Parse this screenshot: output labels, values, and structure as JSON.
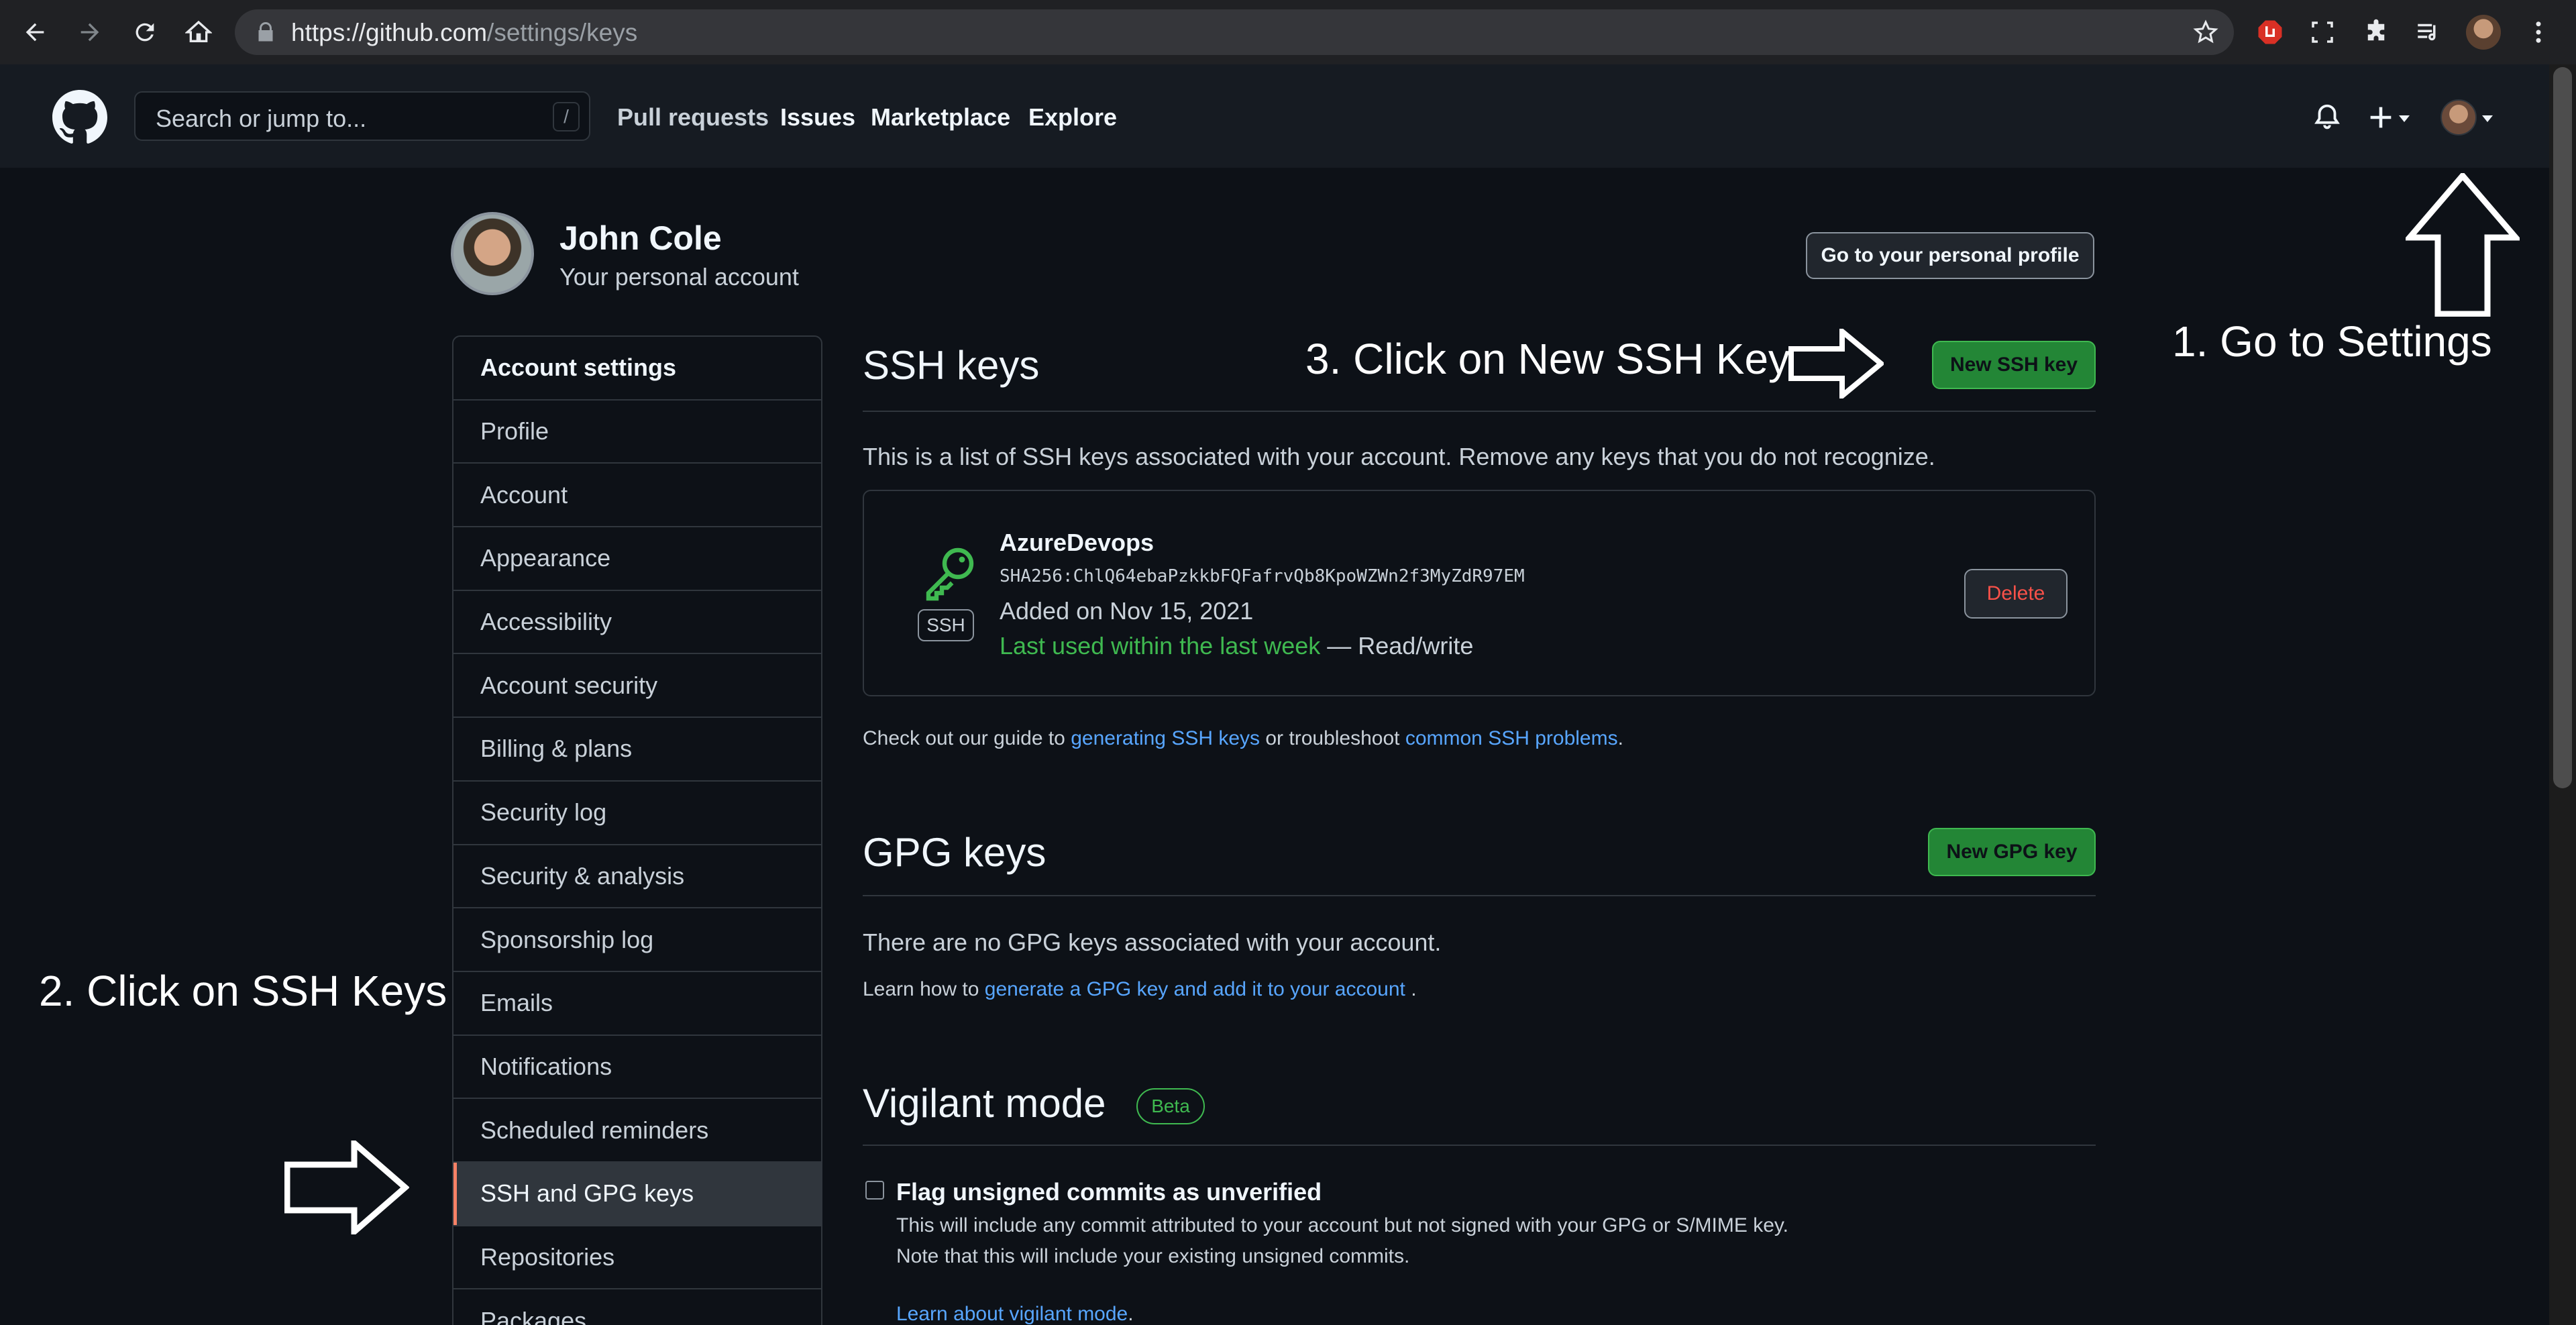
{
  "browser": {
    "url_host": "https://github.com",
    "url_path": "/settings/keys"
  },
  "header": {
    "search_placeholder": "Search or jump to...",
    "search_shortcut": "/",
    "nav": [
      "Pull requests",
      "Issues",
      "Marketplace",
      "Explore"
    ]
  },
  "profile": {
    "name": "John Cole",
    "subtitle": "Your personal account",
    "profile_button": "Go to your personal profile"
  },
  "sidebar": {
    "items": [
      {
        "label": "Account settings",
        "head": true
      },
      {
        "label": "Profile"
      },
      {
        "label": "Account"
      },
      {
        "label": "Appearance"
      },
      {
        "label": "Accessibility"
      },
      {
        "label": "Account security"
      },
      {
        "label": "Billing & plans"
      },
      {
        "label": "Security log"
      },
      {
        "label": "Security & analysis"
      },
      {
        "label": "Sponsorship log"
      },
      {
        "label": "Emails"
      },
      {
        "label": "Notifications"
      },
      {
        "label": "Scheduled reminders"
      },
      {
        "label": "SSH and GPG keys",
        "active": true
      },
      {
        "label": "Repositories"
      },
      {
        "label": "Packages"
      }
    ]
  },
  "ssh": {
    "title": "SSH keys",
    "new_button": "New SSH key",
    "description": "This is a list of SSH keys associated with your account. Remove any keys that you do not recognize.",
    "key": {
      "badge": "SSH",
      "name": "AzureDevops",
      "fingerprint": "SHA256:ChlQ64ebaPzkkbFQFafrvQb8KpoWZWn2f3MyZdR97EM",
      "added": "Added on Nov 15, 2021",
      "last_used": "Last used within the last week",
      "access": " — Read/write",
      "delete_button": "Delete"
    },
    "guide_prefix": "Check out our guide to ",
    "guide_link1": "generating SSH keys",
    "guide_middle": " or troubleshoot ",
    "guide_link2": "common SSH problems",
    "guide_suffix": "."
  },
  "gpg": {
    "title": "GPG keys",
    "new_button": "New GPG key",
    "empty": "There are no GPG keys associated with your account.",
    "learn_prefix": "Learn how to ",
    "learn_link": "generate a GPG key and add it to your account",
    "learn_suffix": " ."
  },
  "vigilant": {
    "title": "Vigilant mode",
    "badge": "Beta",
    "checkbox_label": "Flag unsigned commits as unverified",
    "help1": "This will include any commit attributed to your account but not signed with your GPG or S/MIME key.",
    "help2": "Note that this will include your existing unsigned commits.",
    "learn_link": "Learn about vigilant mode",
    "learn_suffix": "."
  },
  "annotations": {
    "step1": "1. Go to Settings",
    "step2": "2. Click on SSH Keys",
    "step3": "3. Click on New SSH Key"
  },
  "colors": {
    "background": "#0d1117",
    "header": "#161b22",
    "border": "#30363d",
    "link": "#58a6ff",
    "success": "#238636",
    "danger": "#f85149",
    "active_marker": "#f78166"
  }
}
